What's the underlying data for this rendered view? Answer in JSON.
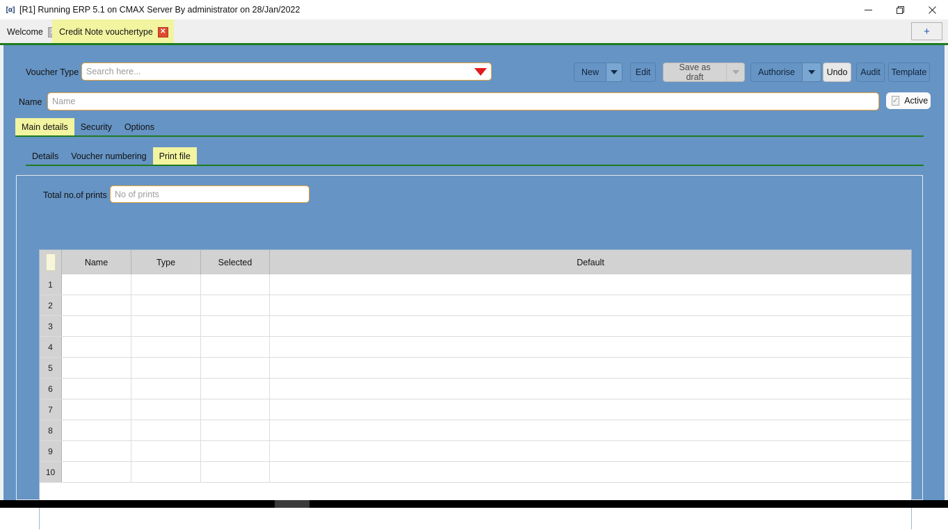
{
  "window": {
    "title": "[R1] Running ERP 5.1 on CMAX Server By administrator on 28/Jan/2022",
    "app_icon": "[α]",
    "minimize": "—",
    "restore": "❐",
    "close": "✕"
  },
  "tabstrip": {
    "tabs": [
      {
        "label": "Welcome",
        "close": "✕",
        "active": false
      },
      {
        "label": "Credit Note vouchertype",
        "close": "✕",
        "active": true
      }
    ],
    "new_tab": "+"
  },
  "form": {
    "voucher_type_label": "Voucher Type",
    "voucher_type_placeholder": "Search here...",
    "voucher_type_value": "",
    "name_label": "Name",
    "name_placeholder": "Name",
    "name_value": "",
    "active_label": "Active",
    "active_checked": true,
    "check_glyph": "✓"
  },
  "toolbar": {
    "new_label": "New",
    "edit_label": "Edit",
    "save_as_draft_label": "Save as draft",
    "authorise_label": "Authorise",
    "undo_label": "Undo",
    "audit_label": "Audit",
    "template_label": "Template"
  },
  "main_tabs": [
    {
      "label": "Main details",
      "active": true
    },
    {
      "label": "Security",
      "active": false
    },
    {
      "label": "Options",
      "active": false
    }
  ],
  "sub_tabs": [
    {
      "label": "Details",
      "active": false
    },
    {
      "label": "Voucher numbering",
      "active": false
    },
    {
      "label": "Print file",
      "active": true
    }
  ],
  "print_panel": {
    "total_prints_label": "Total no.of prints",
    "total_prints_placeholder": "No of prints",
    "total_prints_value": ""
  },
  "grid": {
    "columns": [
      "",
      "Name",
      "Type",
      "Selected",
      "Default"
    ],
    "rows": [
      {
        "num": "1",
        "Name": "",
        "Type": "",
        "Selected": "",
        "Default": ""
      },
      {
        "num": "2",
        "Name": "",
        "Type": "",
        "Selected": "",
        "Default": ""
      },
      {
        "num": "3",
        "Name": "",
        "Type": "",
        "Selected": "",
        "Default": ""
      },
      {
        "num": "4",
        "Name": "",
        "Type": "",
        "Selected": "",
        "Default": ""
      },
      {
        "num": "5",
        "Name": "",
        "Type": "",
        "Selected": "",
        "Default": ""
      },
      {
        "num": "6",
        "Name": "",
        "Type": "",
        "Selected": "",
        "Default": ""
      },
      {
        "num": "7",
        "Name": "",
        "Type": "",
        "Selected": "",
        "Default": ""
      },
      {
        "num": "8",
        "Name": "",
        "Type": "",
        "Selected": "",
        "Default": ""
      },
      {
        "num": "9",
        "Name": "",
        "Type": "",
        "Selected": "",
        "Default": ""
      },
      {
        "num": "10",
        "Name": "",
        "Type": "",
        "Selected": "",
        "Default": ""
      }
    ]
  },
  "colors": {
    "body_blue": "#6694c4",
    "accent_green": "#1e7b1e",
    "tab_yellow": "#f2f4a0",
    "field_border_orange": "#e8a33d",
    "dropdown_red": "#e01b1b",
    "grid_header_gray": "#d2d2d2"
  }
}
